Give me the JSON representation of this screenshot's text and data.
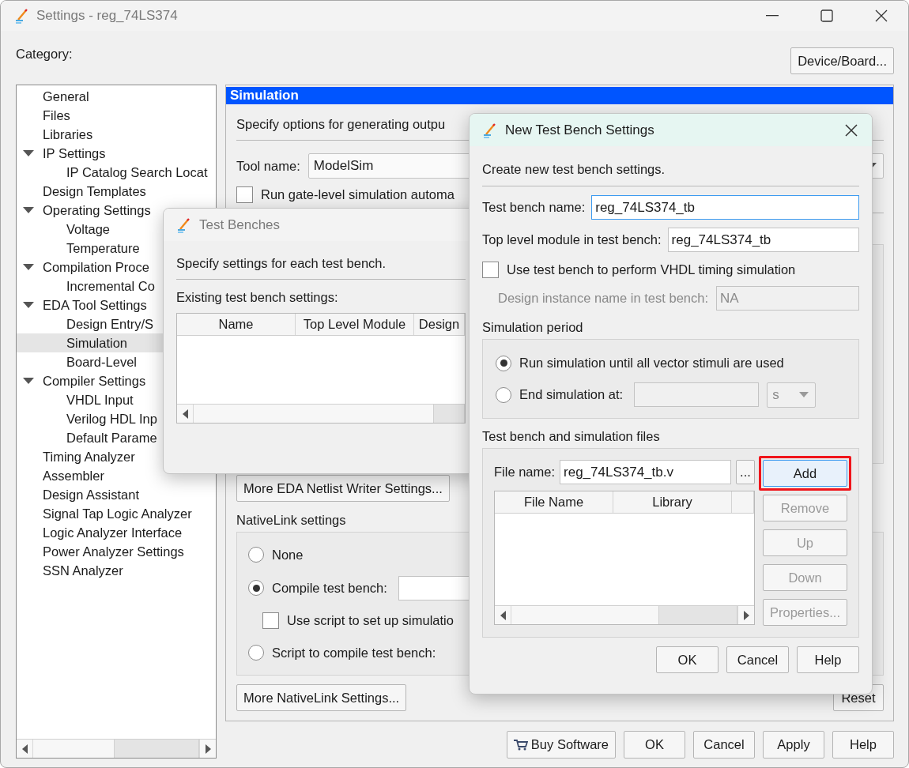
{
  "window": {
    "title": "Settings - reg_74LS374"
  },
  "category_label": "Category:",
  "device_button": "Device/Board...",
  "category_tree": [
    {
      "label": "General",
      "selected": false
    },
    {
      "label": "Files",
      "selected": false
    },
    {
      "label": "Libraries",
      "selected": false
    },
    {
      "label": "IP Settings",
      "selected": false,
      "expanded": true,
      "children": [
        {
          "label": "IP Catalog Search Locat",
          "selected": false
        }
      ]
    },
    {
      "label": "Design Templates",
      "selected": false
    },
    {
      "label": "Operating Settings",
      "selected": false,
      "expanded": true,
      "children": [
        {
          "label": "Voltage",
          "selected": false
        },
        {
          "label": "Temperature",
          "selected": false
        }
      ]
    },
    {
      "label": "Compilation Proce",
      "selected": false,
      "expanded": true,
      "children": [
        {
          "label": "Incremental Co",
          "selected": false
        }
      ]
    },
    {
      "label": "EDA Tool Settings",
      "selected": false,
      "expanded": true,
      "children": [
        {
          "label": "Design Entry/S",
          "selected": false
        },
        {
          "label": "Simulation",
          "selected": true
        },
        {
          "label": "Board-Level",
          "selected": false
        }
      ]
    },
    {
      "label": "Compiler Settings",
      "selected": false,
      "expanded": true,
      "children": [
        {
          "label": "VHDL Input",
          "selected": false
        },
        {
          "label": "Verilog HDL Inp",
          "selected": false
        },
        {
          "label": "Default Parame",
          "selected": false
        }
      ]
    },
    {
      "label": "Timing Analyzer",
      "selected": false
    },
    {
      "label": "Assembler",
      "selected": false
    },
    {
      "label": "Design Assistant",
      "selected": false
    },
    {
      "label": "Signal Tap Logic Analyzer",
      "selected": false
    },
    {
      "label": "Logic Analyzer Interface",
      "selected": false
    },
    {
      "label": "Power Analyzer Settings",
      "selected": false
    },
    {
      "label": "SSN Analyzer",
      "selected": false
    }
  ],
  "panel": {
    "title": "Simulation",
    "description": "Specify options for generating outpu",
    "tool_name_label": "Tool name:",
    "tool_name_value": "ModelSim",
    "gate_level": {
      "label": "Run gate-level simulation automa",
      "checked": false
    },
    "eda_button": "More EDA Netlist Writer Settings...",
    "nativelink": {
      "title": "NativeLink settings",
      "options": [
        {
          "kind": "radio",
          "label": "None",
          "selected": false
        },
        {
          "kind": "radio_field",
          "label": "Compile test bench:",
          "selected": true
        },
        {
          "kind": "checkbox",
          "label": "Use script to set up simulatio",
          "checked": false
        },
        {
          "kind": "radio",
          "label": "Script to compile test bench:",
          "selected": false
        }
      ]
    },
    "nativelink_button": "More NativeLink Settings...",
    "reset_button": "Reset"
  },
  "footer_buttons": [
    {
      "kind": "cart",
      "label": "Buy Software"
    },
    {
      "kind": "plain",
      "label": "OK"
    },
    {
      "kind": "plain",
      "label": "Cancel"
    },
    {
      "kind": "plain",
      "label": "Apply"
    },
    {
      "kind": "plain",
      "label": "Help"
    }
  ],
  "test_benches_dialog": {
    "title": "Test Benches",
    "description": "Specify settings for each test bench.",
    "list_label": "Existing test bench settings:",
    "columns": [
      "Name",
      "Top Level Module",
      "Design"
    ]
  },
  "new_dialog": {
    "title": "New Test Bench Settings",
    "description": "Create new test bench settings.",
    "name_field": {
      "label": "Test bench name:",
      "value": "reg_74LS374_tb",
      "focused": true
    },
    "top_field": {
      "label": "Top level module in test bench:",
      "value": "reg_74LS374_tb"
    },
    "vhdl_timing": {
      "label": "Use test bench to perform VHDL timing simulation",
      "checked": false
    },
    "instance_field": {
      "label": "Design instance name in test bench:",
      "value": "NA",
      "disabled": true
    },
    "period": {
      "title": "Simulation period",
      "options": [
        {
          "kind": "radio",
          "label": "Run simulation until all vector stimuli are used",
          "selected": true
        },
        {
          "kind": "radio_time",
          "label": "End simulation at:",
          "selected": false,
          "unit": "s"
        }
      ]
    },
    "files": {
      "title": "Test bench and simulation files",
      "file_label": "File name:",
      "file_value": "reg_74LS374_tb.v",
      "browse": "...",
      "columns": [
        "File Name",
        "Library"
      ],
      "buttons": [
        {
          "label": "Add",
          "disabled": false,
          "highlighted": true
        },
        {
          "label": "Remove",
          "disabled": true,
          "highlighted": false
        },
        {
          "label": "Up",
          "disabled": true,
          "highlighted": false
        },
        {
          "label": "Down",
          "disabled": true,
          "highlighted": false
        },
        {
          "label": "Properties...",
          "disabled": true,
          "highlighted": false
        }
      ]
    },
    "buttons": [
      "OK",
      "Cancel",
      "Help"
    ]
  }
}
